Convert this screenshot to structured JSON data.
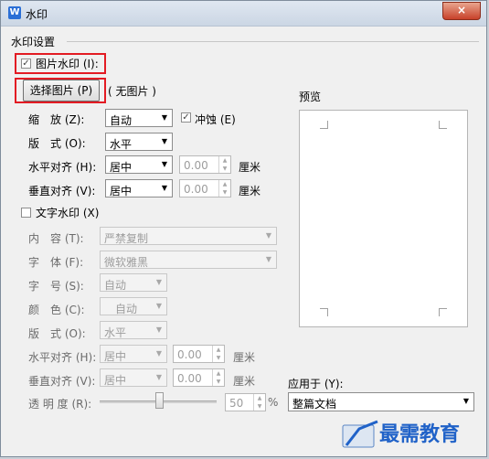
{
  "window": {
    "title": "水印",
    "close_label": "×"
  },
  "section_title": "水印设置",
  "image_wm": {
    "checkbox_label": "图片水印 (I):",
    "checked": true,
    "choose_button": "选择图片 (P)",
    "no_image": "( 无图片 )",
    "scale_label": "缩　放 (Z):",
    "scale_value": "自动",
    "washout_label": "冲蚀 (E)",
    "washout_checked": true,
    "layout_label": "版　式 (O):",
    "layout_value": "水平",
    "h_align_label": "水平对齐 (H):",
    "h_align_value": "居中",
    "h_offset": "0.00",
    "v_align_label": "垂直对齐 (V):",
    "v_align_value": "居中",
    "v_offset": "0.00",
    "unit": "厘米"
  },
  "text_wm": {
    "checkbox_label": "文字水印 (X)",
    "checked": false,
    "content_label": "内　容 (T):",
    "content_value": "严禁复制",
    "font_label": "字　体 (F):",
    "font_value": "微软雅黑",
    "size_label": "字　号 (S):",
    "size_value": "自动",
    "color_label": "颜　色 (C):",
    "color_value": "自动",
    "layout_label": "版　式 (O):",
    "layout_value": "水平",
    "h_align_label": "水平对齐 (H):",
    "h_align_value": "居中",
    "h_offset": "0.00",
    "v_align_label": "垂直对齐 (V):",
    "v_align_value": "居中",
    "v_offset": "0.00",
    "unit": "厘米",
    "transparency_label": "透 明 度 (R):",
    "transparency_value": "50",
    "transparency_unit": "%"
  },
  "preview": {
    "label": "预览"
  },
  "apply": {
    "label": "应用于 (Y):",
    "value": "整篇文档"
  },
  "overlay": {
    "watermark_text": "最需教育"
  },
  "colors": {
    "highlight": "#e31b23",
    "titlebar": "#cbd6e4",
    "overlay_blue": "#2062c8"
  }
}
